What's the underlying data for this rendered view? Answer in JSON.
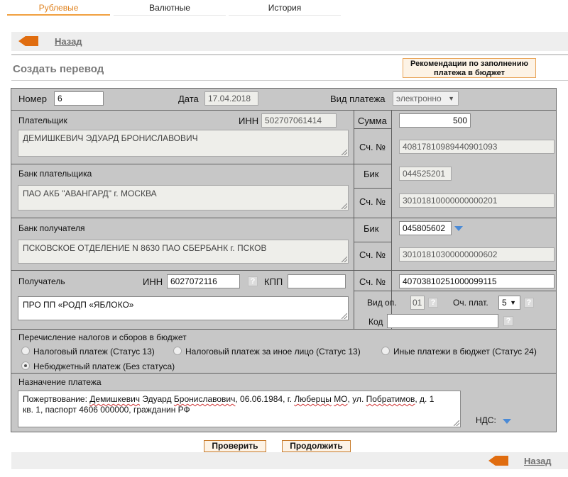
{
  "tabs": [
    {
      "label": "Рублевые",
      "active": true
    },
    {
      "label": "Валютные",
      "active": false
    },
    {
      "label": "История",
      "active": false
    }
  ],
  "nav": {
    "back_label": "Назад"
  },
  "page": {
    "title": "Создать перевод",
    "recommend_label_line1": "Рекомендации по заполнению",
    "recommend_label_line2": "платежа в бюджет"
  },
  "form": {
    "number_label": "Номер",
    "number_value": "6",
    "date_label": "Дата",
    "date_value": "17.04.2018",
    "payment_type_label": "Вид платежа",
    "payment_type_value": "электронно",
    "payer_label": "Плательщик",
    "payer_inn_label": "ИНН",
    "payer_inn_value": "502707061414",
    "payer_name": "ДЕМИШКЕВИЧ ЭДУАРД БРОНИСЛАВОВИЧ",
    "amount_label": "Сумма",
    "amount_value": "500",
    "acc_label": "Сч. №",
    "payer_account": "40817810989440901093",
    "payer_bank_label": "Банк плательщика",
    "payer_bank_name": "ПАО АКБ \"АВАНГАРД\" г. МОСКВА",
    "bik_label": "Бик",
    "payer_bik": "044525201",
    "payer_corr_account": "30101810000000000201",
    "payee_bank_label": "Банк получателя",
    "payee_bank_name": "ПСКОВСКОЕ ОТДЕЛЕНИЕ N 8630 ПАО СБЕРБАНК г. ПСКОВ",
    "payee_bik": "045805602",
    "payee_corr_account": "30101810300000000602",
    "payee_label": "Получатель",
    "payee_inn_label": "ИНН",
    "payee_inn_value": "6027072116",
    "payee_kpp_label": "КПП",
    "payee_kpp_value": "",
    "payee_account": "40703810251000099115",
    "payee_name": "ПРО ПП «РОДП «ЯБЛОКО»",
    "op_type_label": "Вид оп.",
    "op_type_value": "01",
    "priority_label": "Оч. плат.",
    "priority_value": "5",
    "code_label": "Код",
    "code_value": "",
    "question_mark": "?",
    "tax_section_label": "Перечисление налогов и сборов в бюджет",
    "tax_options": [
      {
        "label": "Налоговый платеж (Статус 13)",
        "selected": false
      },
      {
        "label": "Налоговый платеж за иное лицо (Статус 13)",
        "selected": false
      },
      {
        "label": "Иные платежи в бюджет (Статус 24)",
        "selected": false
      },
      {
        "label": "Небюджетный платеж (Без статуса)",
        "selected": true
      }
    ],
    "purpose_label": "Назначение платежа",
    "purpose_line1_parts": [
      "Пожертвование: ",
      "Демишкевич",
      " Эдуард ",
      "Брониславович",
      ", 06.06.1984, г. ",
      "Люберцы",
      " ",
      "МО",
      ", ул. ",
      "Побратимов",
      ", д. 1"
    ],
    "purpose_line2": "кв. 1, паспорт 4606 000000, гражданин РФ",
    "vat_label": "НДС:"
  },
  "actions": {
    "check_label": "Проверить",
    "continue_label": "Продолжить"
  },
  "colors": {
    "accent": "#e0821e",
    "arrow": "#e06d10",
    "panel": "#c7c7c7",
    "info_triangle": "#4a8ad6"
  }
}
